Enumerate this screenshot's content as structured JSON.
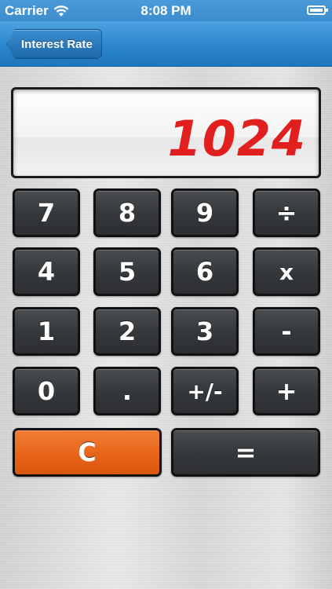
{
  "status_bar": {
    "carrier": "Carrier",
    "time": "8:08 PM"
  },
  "nav": {
    "back_label": "Interest Rate"
  },
  "display": {
    "value": "1024",
    "color": "#e11f1f"
  },
  "keys": {
    "k7": "7",
    "k8": "8",
    "k9": "9",
    "divide": "÷",
    "k4": "4",
    "k5": "5",
    "k6": "6",
    "multiply": "x",
    "k1": "1",
    "k2": "2",
    "k3": "3",
    "minus": "-",
    "k0": "0",
    "decimal": ".",
    "sign": "+/-",
    "plus": "+",
    "clear": "C",
    "equals": "="
  },
  "colors": {
    "accent": "#2b86cc",
    "clear_key": "#e8651a",
    "key_dark": "#36393c"
  }
}
